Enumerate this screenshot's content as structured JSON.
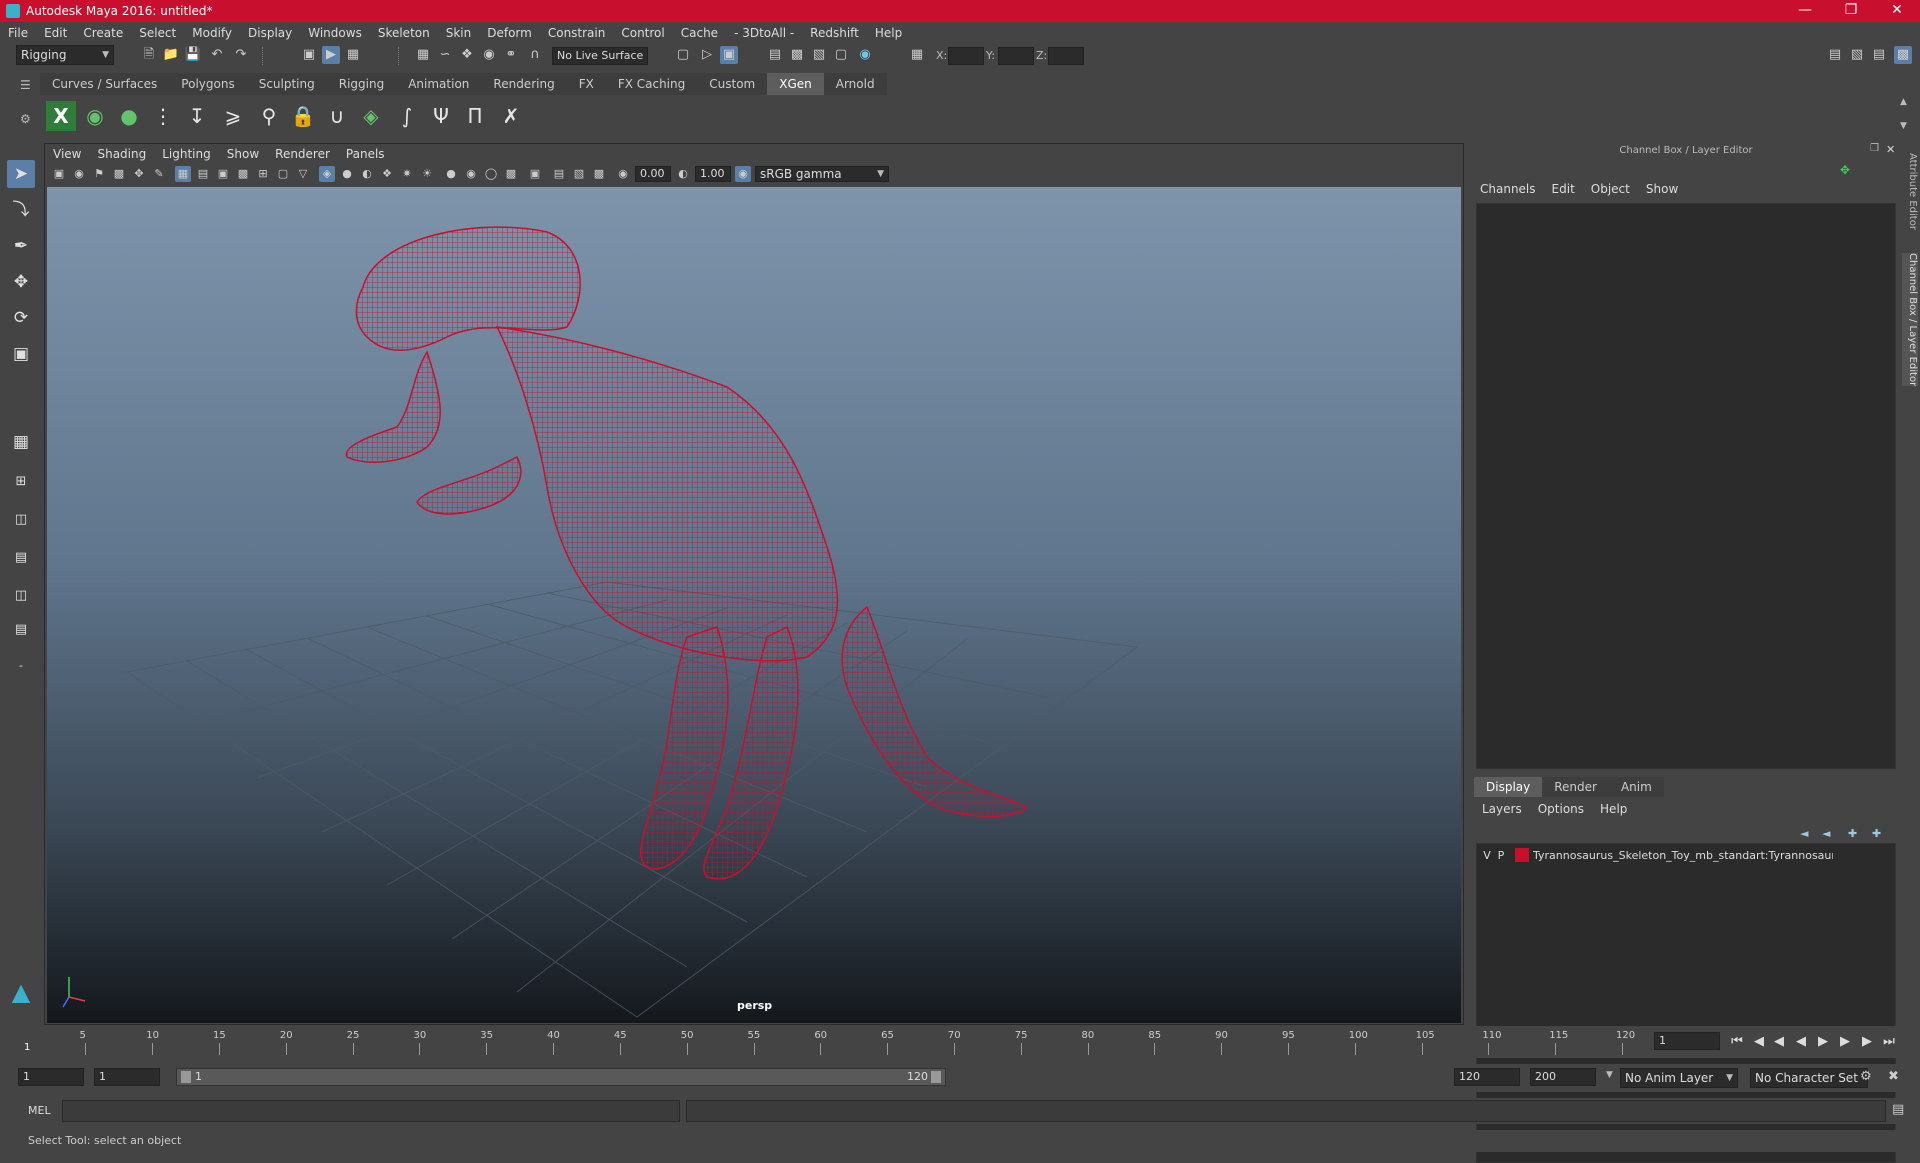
{
  "window": {
    "title": "Autodesk Maya 2016: untitled*"
  },
  "menubar": [
    "File",
    "Edit",
    "Create",
    "Select",
    "Modify",
    "Display",
    "Windows",
    "Skeleton",
    "Skin",
    "Deform",
    "Constrain",
    "Control",
    "Cache",
    "- 3DtoAll -",
    "Redshift",
    "Help"
  ],
  "statusline": {
    "menu_set": "Rigging",
    "live_surface": "No Live Surface",
    "x_label": "X:",
    "y_label": "Y:",
    "z_label": "Z:"
  },
  "shelf": {
    "tabs": [
      "Curves / Surfaces",
      "Polygons",
      "Sculpting",
      "Rigging",
      "Animation",
      "Rendering",
      "FX",
      "FX Caching",
      "Custom",
      "XGen",
      "Arnold"
    ],
    "active_tab": "XGen"
  },
  "viewport": {
    "menu": [
      "View",
      "Shading",
      "Lighting",
      "Show",
      "Renderer",
      "Panels"
    ],
    "exposure": "0.00",
    "gamma": "1.00",
    "color_space": "sRGB gamma",
    "camera_label": "persp",
    "wireframe_color": "#c8102e"
  },
  "channel_box": {
    "title": "Channel Box / Layer Editor",
    "menu": [
      "Channels",
      "Edit",
      "Object",
      "Show"
    ]
  },
  "layer_editor": {
    "tabs": [
      "Display",
      "Render",
      "Anim"
    ],
    "menu": [
      "Layers",
      "Options",
      "Help"
    ],
    "layer": {
      "v": "V",
      "p": "P",
      "name": "Tyrannosaurus_Skeleton_Toy_mb_standart:Tyrannosaurus",
      "color": "#c8102e"
    }
  },
  "side_tabs": [
    "Attribute Editor",
    "Channel Box / Layer Editor"
  ],
  "timeslider": {
    "ticks": [
      "5",
      "10",
      "15",
      "20",
      "25",
      "30",
      "35",
      "40",
      "45",
      "50",
      "55",
      "60",
      "65",
      "70",
      "75",
      "80",
      "85",
      "90",
      "95",
      "100",
      "105",
      "110",
      "115",
      "120"
    ],
    "current_frame_marker": "1",
    "current_frame": "1"
  },
  "range": {
    "start": "1",
    "playback_start": "1",
    "bar_start": "1",
    "bar_end": "120",
    "playback_end": "120",
    "end": "200",
    "anim_layer": "No Anim Layer",
    "character_set": "No Character Set"
  },
  "cmdline": {
    "label": "MEL"
  },
  "helpline": {
    "text": "Select Tool: select an object"
  },
  "accent_color": "#5b7fa6",
  "title_color": "#c8102e"
}
